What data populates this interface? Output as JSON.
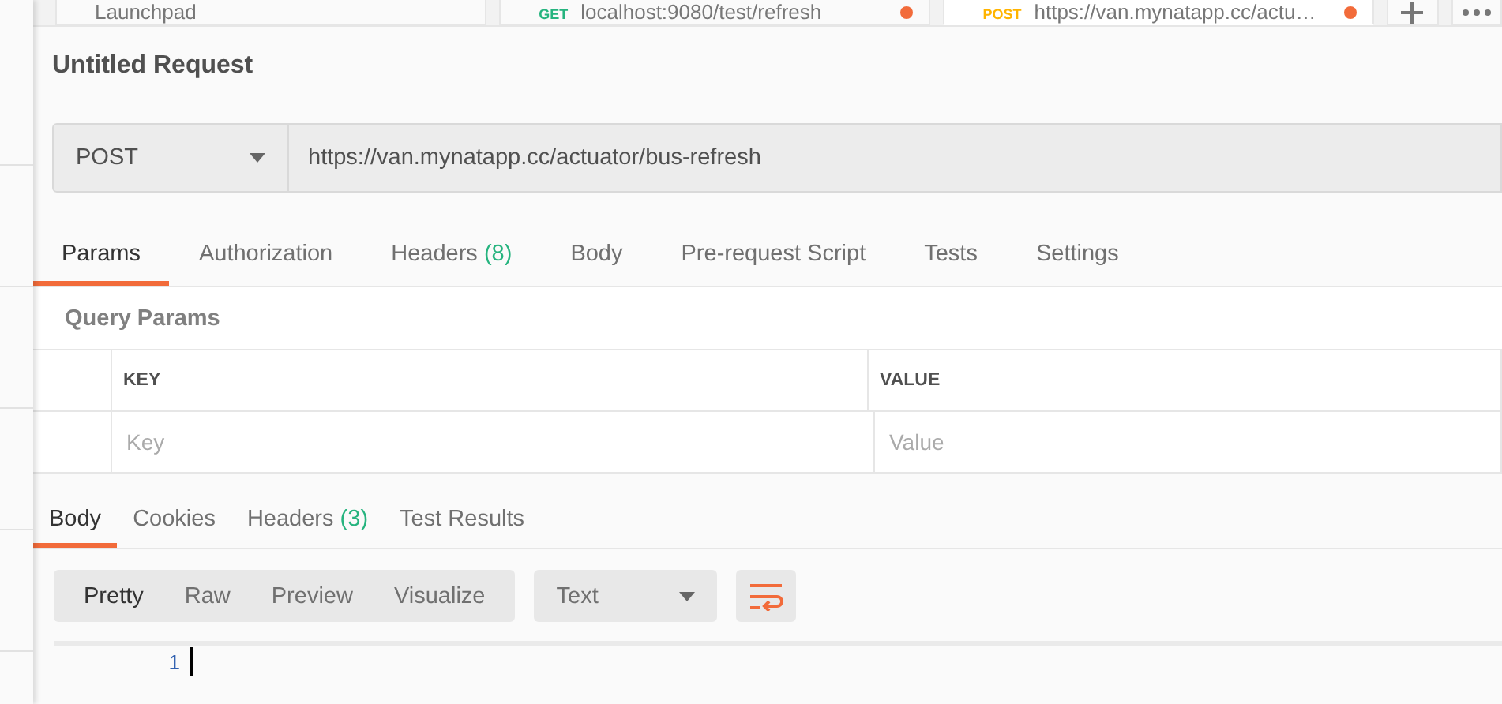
{
  "request_tabs": [
    {
      "title": "Launchpad",
      "selected": false,
      "unsaved": false
    },
    {
      "method": {
        "label": "GET",
        "color": "#26b47f"
      },
      "title": "localhost:9080/test/refresh",
      "selected": false,
      "unsaved": true
    },
    {
      "method": {
        "label": "POST",
        "color": "#ffb400"
      },
      "title": "https://van.mynatapp.cc/actu…",
      "selected": true,
      "unsaved": true
    }
  ],
  "request": {
    "title": "Untitled Request",
    "method": "POST",
    "url": "https://van.mynatapp.cc/actuator/bus-refresh"
  },
  "request_sections": [
    {
      "label": "Params",
      "selected": true
    },
    {
      "label": "Authorization",
      "selected": false
    },
    {
      "label": "Headers",
      "count": "(8)",
      "selected": false
    },
    {
      "label": "Body",
      "selected": false
    },
    {
      "label": "Pre-request Script",
      "selected": false
    },
    {
      "label": "Tests",
      "selected": false
    },
    {
      "label": "Settings",
      "selected": false
    }
  ],
  "query_params": {
    "title": "Query Params",
    "columns": [
      "KEY",
      "VALUE"
    ],
    "placeholders": [
      "Key",
      "Value"
    ]
  },
  "response_sections": [
    {
      "label": "Body",
      "selected": true
    },
    {
      "label": "Cookies",
      "selected": false
    },
    {
      "label": "Headers",
      "count": "(3)",
      "selected": false
    },
    {
      "label": "Test Results",
      "selected": false
    }
  ],
  "view_modes": [
    {
      "label": "Pretty",
      "selected": true
    },
    {
      "label": "Raw",
      "selected": false
    },
    {
      "label": "Preview",
      "selected": false
    },
    {
      "label": "Visualize",
      "selected": false
    }
  ],
  "format": "Text",
  "wrap_lines": true,
  "editor": {
    "line_numbers": [
      "1"
    ]
  }
}
